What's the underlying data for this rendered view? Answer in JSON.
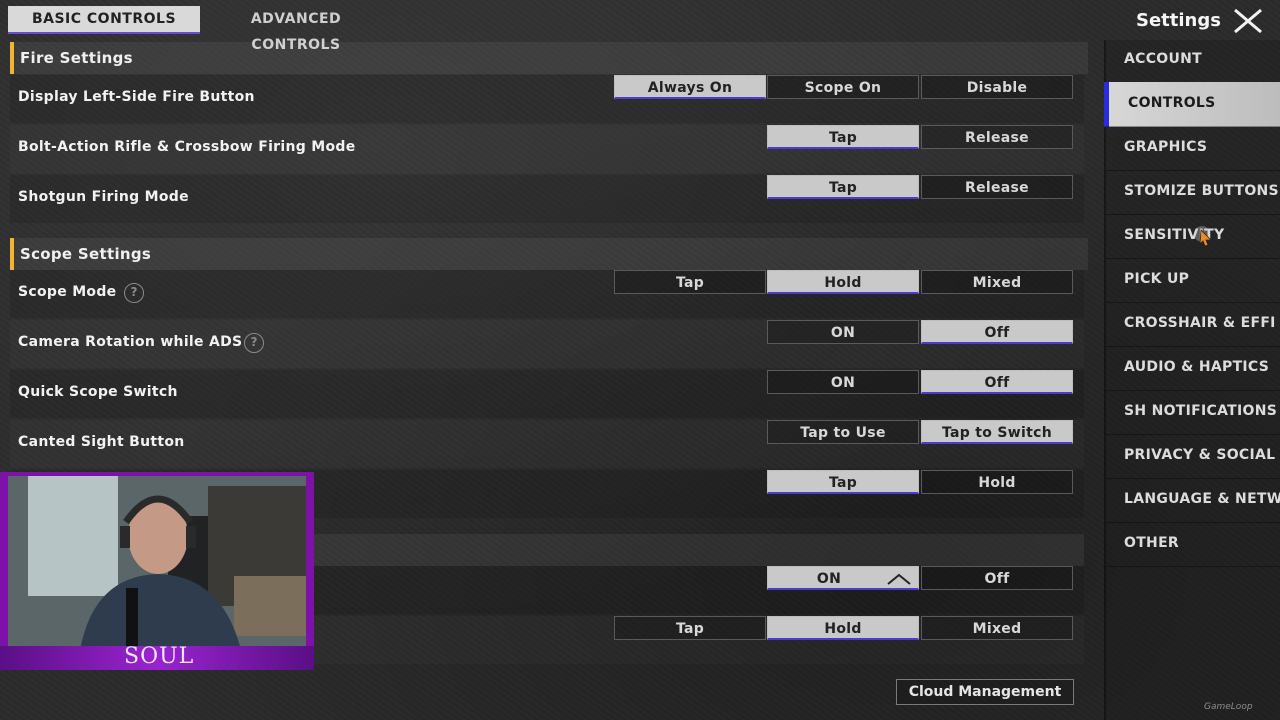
{
  "tabs": {
    "basic": "BASIC CONTROLS",
    "advanced": "ADVANCED CONTROLS"
  },
  "header": {
    "title": "Settings"
  },
  "sections": {
    "fire": "Fire Settings",
    "scope": "Scope Settings"
  },
  "rows": {
    "left_fire": {
      "label": "Display Left-Side Fire Button",
      "options": [
        "Always On",
        "Scope On",
        "Disable"
      ]
    },
    "bolt": {
      "label": "Bolt-Action Rifle & Crossbow Firing Mode",
      "options": [
        "Tap",
        "Release"
      ]
    },
    "shotgun": {
      "label": "Shotgun Firing Mode",
      "options": [
        "Tap",
        "Release"
      ]
    },
    "scope_mode": {
      "label": "Scope Mode",
      "options": [
        "Tap",
        "Hold",
        "Mixed"
      ]
    },
    "camera_rot": {
      "label": "Camera Rotation while ADS",
      "options": [
        "ON",
        "Off"
      ]
    },
    "quick_scope": {
      "label": "Quick Scope Switch",
      "options": [
        "ON",
        "Off"
      ]
    },
    "canted": {
      "label": "Canted Sight Button",
      "options": [
        "Tap to Use",
        "Tap to Switch"
      ]
    },
    "row9": {
      "options": [
        "Tap",
        "Hold"
      ]
    },
    "row10": {
      "options": [
        "ON",
        "Off"
      ]
    },
    "row11": {
      "options": [
        "Tap",
        "Hold",
        "Mixed"
      ]
    }
  },
  "nav": [
    "ACCOUNT",
    "CONTROLS",
    "GRAPHICS",
    "STOMIZE BUTTONS",
    "SENSITIVITY",
    "PICK UP",
    "CROSSHAIR & EFFI",
    "AUDIO & HAPTICS",
    "SH NOTIFICATIONS",
    "PRIVACY & SOCIAL",
    "LANGUAGE & NETW",
    "OTHER"
  ],
  "cloud_button": "Cloud Management",
  "webcam": {
    "name": "SOUL"
  },
  "watermark": "GameLoop",
  "colors": {
    "accent_purple": "#4b3bd0",
    "section_marker": "#f0b532",
    "webcam_frame": "#7d12a8"
  }
}
